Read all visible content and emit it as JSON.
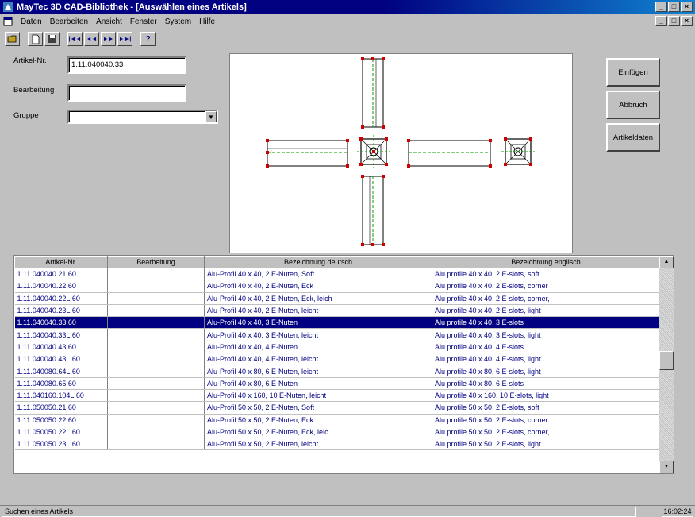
{
  "window": {
    "title": "MayTec 3D CAD-Bibliothek - [Auswählen eines Artikels]",
    "controls": [
      "_",
      "□",
      "×"
    ]
  },
  "menu": [
    {
      "label": "Daten"
    },
    {
      "label": "Bearbeiten"
    },
    {
      "label": "Ansicht"
    },
    {
      "label": "Fenster"
    },
    {
      "label": "System"
    },
    {
      "label": "Hilfe"
    }
  ],
  "toolbar": {
    "first": "|◄◄",
    "prev": "◄◄",
    "next": "►►",
    "last": "►►|",
    "help": "?"
  },
  "form": {
    "artikel_label": "Artikel-Nr.",
    "artikel_value": "1.11.040040.33",
    "bearbeitung_label": "Bearbeitung",
    "bearbeitung_value": "",
    "gruppe_label": "Gruppe",
    "gruppe_value": ""
  },
  "buttons": {
    "insert": "Einfügen",
    "cancel": "Abbruch",
    "article_data": "Artikeldaten"
  },
  "table": {
    "columns": [
      "Artikel-Nr.",
      "Bearbeitung",
      "Bezeichnung deutsch",
      "Bezeichnung englisch"
    ],
    "rows": [
      [
        "1.11.040040.21.60",
        "",
        "Alu-Profil 40 x 40, 2 E-Nuten, Soft",
        "Alu profile 40 x 40, 2 E-slots, soft"
      ],
      [
        "1.11.040040.22.60",
        "",
        "Alu-Profil 40 x 40, 2 E-Nuten, Eck",
        "Alu profile 40 x 40, 2 E-slots, corner"
      ],
      [
        "1.11.040040.22L.60",
        "",
        "Alu-Profil 40 x 40, 2 E-Nuten, Eck, leich",
        "Alu profile 40 x 40, 2 E-slots, corner,"
      ],
      [
        "1.11.040040.23L.60",
        "",
        "Alu-Profil 40 x 40, 2 E-Nuten, leicht",
        "Alu profile 40 x 40, 2 E-slots, light"
      ],
      [
        "1.11.040040.33.60",
        "",
        "Alu-Profil 40 x 40, 3 E-Nuten",
        "Alu profile 40 x 40, 3 E-slots"
      ],
      [
        "1.11.040040.33L.60",
        "",
        "Alu-Profil 40 x 40, 3 E-Nuten, leicht",
        "Alu profile 40 x 40, 3 E-slots, light"
      ],
      [
        "1.11.040040.43.60",
        "",
        "Alu-Profil 40 x 40, 4 E-Nuten",
        "Alu profile 40 x 40, 4 E-slots"
      ],
      [
        "1.11.040040.43L.60",
        "",
        "Alu-Profil 40 x 40, 4 E-Nuten, leicht",
        "Alu profile 40 x 40, 4 E-slots, light"
      ],
      [
        "1.11.040080.64L.60",
        "",
        "Alu-Profil 40 x 80, 6 E-Nuten, leicht",
        "Alu profile 40 x 80, 6 E-slots, light"
      ],
      [
        "1.11.040080.65.60",
        "",
        "Alu-Profil 40 x 80, 6 E-Nuten",
        "Alu profile 40 x 80, 6 E-slots"
      ],
      [
        "1.11.040160.104L.60",
        "",
        "Alu-Profil 40 x 160, 10 E-Nuten, leicht",
        "Alu profile 40 x 160, 10 E-slots, light"
      ],
      [
        "1.11.050050.21.60",
        "",
        "Alu-Profil 50 x 50, 2 E-Nuten, Soft",
        "Alu profile 50 x 50, 2 E-slots, soft"
      ],
      [
        "1.11.050050.22.60",
        "",
        "Alu-Profil 50 x 50, 2 E-Nuten, Eck",
        "Alu profile 50 x 50, 2 E-slots, corner"
      ],
      [
        "1.11.050050.22L.60",
        "",
        "Alu-Profil 50 x 50, 2 E-Nuten, Eck, leic",
        "Alu profile 50 x 50, 2 E-slots, corner,"
      ],
      [
        "1.11.050050.23L.60",
        "",
        "Alu-Profil 50 x 50, 2 E-Nuten, leicht",
        "Alu profile 50 x 50, 2 E-slots, light"
      ]
    ],
    "selected_index": 4
  },
  "status": {
    "text": "Suchen eines Artikels",
    "time": "16:02:24"
  },
  "colors": {
    "title_bar": "#000080",
    "selection": "#000080",
    "preview_outline": "#000000",
    "preview_handles": "#cc0000",
    "preview_centerline": "#00a000"
  }
}
